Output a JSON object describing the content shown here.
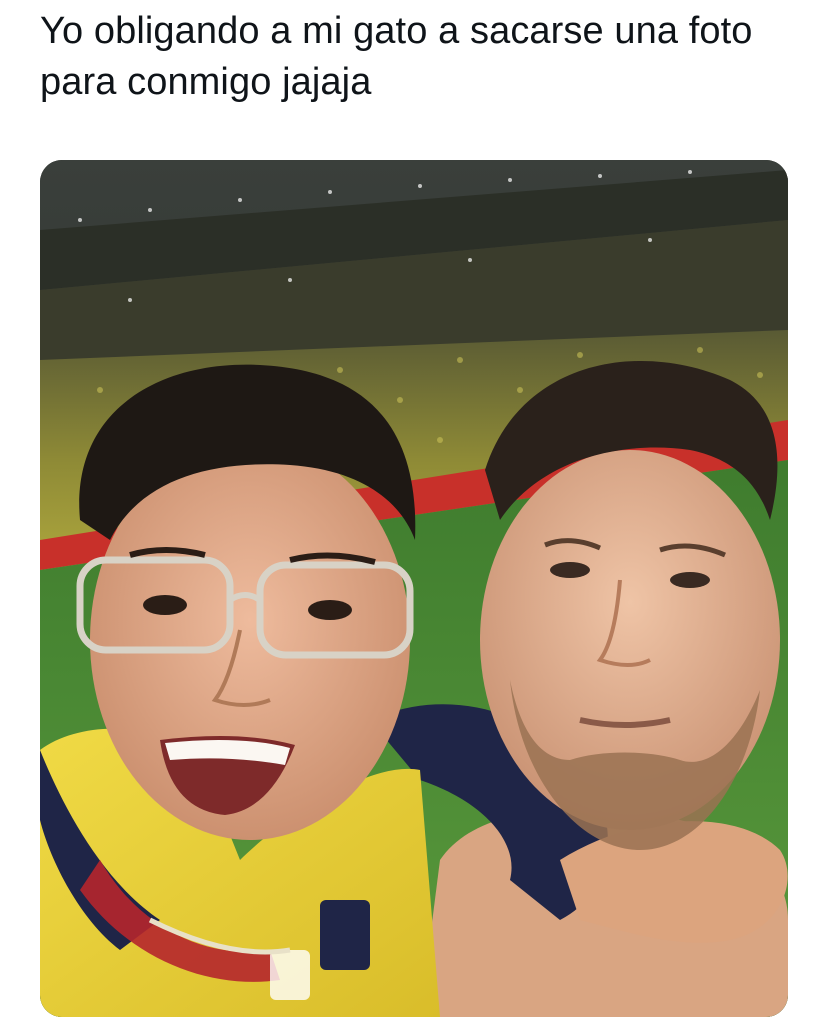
{
  "tweet": {
    "text": "Yo obligando a mi gato a sacarse una foto para conmigo jajaja"
  },
  "photo": {
    "description_icon": "selfie-photo",
    "colors": {
      "stadium_dark": "#1c2218",
      "crowd_yellow": "#a9a43a",
      "pitch_green": "#4c8a34",
      "ad_board_red": "#c8302a",
      "jersey_yellow": "#e9d23a",
      "jersey_navy": "#1f2547",
      "skin_light": "#e6b393",
      "skin_warm": "#d9a07c",
      "hair_dark": "#1e1814"
    }
  }
}
